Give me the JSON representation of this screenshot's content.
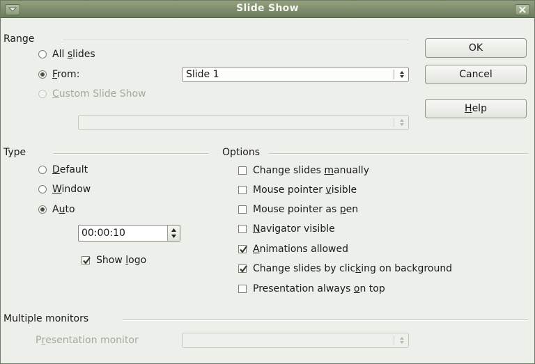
{
  "window": {
    "title": "Slide Show"
  },
  "range": {
    "label": "Range",
    "all_slides": {
      "label": "All slides",
      "mnemonic_index": 4,
      "checked": false
    },
    "from": {
      "label": "From:",
      "checked": true
    },
    "from_value": "Slide 1",
    "custom_show": {
      "label": "Custom Slide Show",
      "checked": false,
      "disabled": true
    },
    "custom_show_value": ""
  },
  "buttons": {
    "ok": "OK",
    "cancel": "Cancel",
    "help": "Help"
  },
  "type": {
    "label": "Type",
    "default": {
      "label": "Default",
      "checked": false
    },
    "window": {
      "label": "Window",
      "checked": false
    },
    "auto": {
      "label": "Auto",
      "checked": true
    },
    "pause": "00:00:10",
    "show_logo": {
      "label": "Show logo",
      "checked": true
    }
  },
  "options": {
    "label": "Options",
    "items": [
      {
        "label": "Change slides manually",
        "checked": false
      },
      {
        "label": "Mouse pointer visible",
        "checked": false
      },
      {
        "label": "Mouse pointer as pen",
        "checked": false
      },
      {
        "label": "Navigator visible",
        "checked": false
      },
      {
        "label": "Animations allowed",
        "checked": true
      },
      {
        "label": "Change slides by clicking on background",
        "checked": true
      },
      {
        "label": "Presentation always on top",
        "checked": false
      }
    ]
  },
  "monitors": {
    "label": "Multiple monitors",
    "presentation_monitor": "Presentation monitor",
    "presentation_monitor_value": ""
  },
  "icons": {
    "window_menu": "window-menu-icon",
    "close": "close-icon",
    "checkmark": "checkmark-icon",
    "spin_arrows": "spin-arrows-icon"
  },
  "colors": {
    "titlebar": "#7f8e6b",
    "dialog_bg": "#edf0ea",
    "disabled_text": "#a4a8a0"
  }
}
